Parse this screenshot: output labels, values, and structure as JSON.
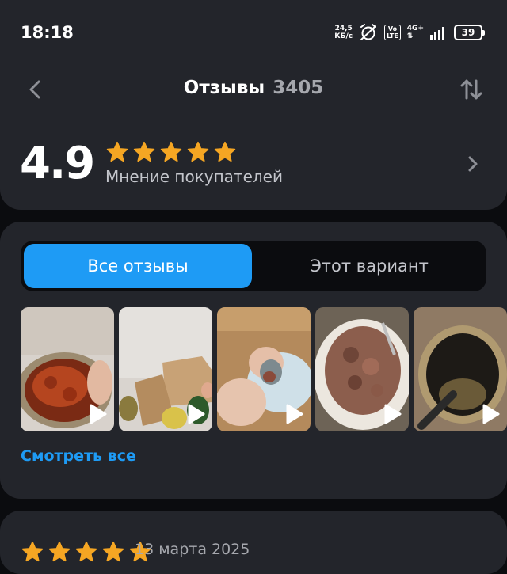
{
  "status_bar": {
    "time": "18:18",
    "net_speed_value": "24,5",
    "net_speed_unit": "КБ/с",
    "vo_top": "Vo",
    "vo_bottom": "LTE",
    "network": "4G+",
    "battery": "39"
  },
  "header": {
    "title": "Отзывы",
    "count": "3405",
    "back_icon": "chevron-left-icon",
    "sort_icon": "sort-arrows-icon"
  },
  "rating": {
    "value": "4.9",
    "stars": 5,
    "label": "Мнение покупателей"
  },
  "tabs": {
    "all": "Все отзывы",
    "variant": "Этот вариант"
  },
  "media": {
    "see_all": "Смотреть все",
    "items": [
      {
        "type": "video",
        "subject": "open can with red fish pieces"
      },
      {
        "type": "video",
        "subject": "cans and cardboard boxes on floor"
      },
      {
        "type": "video",
        "subject": "hand holding can over plate"
      },
      {
        "type": "video",
        "subject": "meat pieces on plate with fork"
      },
      {
        "type": "video",
        "subject": "open empty can with spoon"
      }
    ]
  },
  "review": {
    "stars": 5,
    "date": "13 марта 2025"
  },
  "colors": {
    "accent": "#1e9bf5",
    "star": "#f5a623",
    "card": "#23252b",
    "background": "#0b0c0f"
  }
}
